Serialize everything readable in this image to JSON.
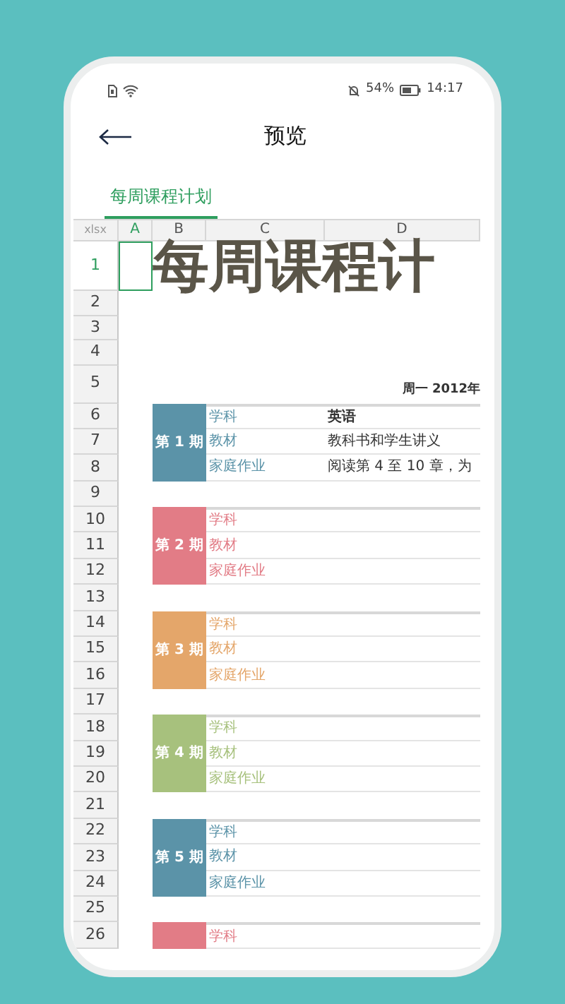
{
  "status_bar": {
    "battery": "54%",
    "time": "14:17"
  },
  "header": {
    "title": "预览"
  },
  "tabs": [
    {
      "label": "每周课程计划",
      "selected": true
    }
  ],
  "sheet": {
    "corner": "xlsx",
    "columns": [
      {
        "label": "A",
        "selected": true
      },
      {
        "label": "B",
        "selected": false
      },
      {
        "label": "C",
        "selected": false
      },
      {
        "label": "D",
        "selected": false
      }
    ],
    "rows": [
      {
        "label": "1",
        "selected": true
      },
      {
        "label": "2",
        "selected": false
      },
      {
        "label": "3",
        "selected": false
      },
      {
        "label": "4",
        "selected": false
      },
      {
        "label": "5",
        "selected": false
      },
      {
        "label": "6",
        "selected": false
      },
      {
        "label": "7",
        "selected": false
      },
      {
        "label": "8",
        "selected": false
      },
      {
        "label": "9",
        "selected": false
      },
      {
        "label": "10",
        "selected": false
      },
      {
        "label": "11",
        "selected": false
      },
      {
        "label": "12",
        "selected": false
      },
      {
        "label": "13",
        "selected": false
      },
      {
        "label": "14",
        "selected": false
      },
      {
        "label": "15",
        "selected": false
      },
      {
        "label": "16",
        "selected": false
      },
      {
        "label": "17",
        "selected": false
      },
      {
        "label": "18",
        "selected": false
      },
      {
        "label": "19",
        "selected": false
      },
      {
        "label": "20",
        "selected": false
      },
      {
        "label": "21",
        "selected": false
      },
      {
        "label": "22",
        "selected": false
      },
      {
        "label": "23",
        "selected": false
      },
      {
        "label": "24",
        "selected": false
      },
      {
        "label": "25",
        "selected": false
      },
      {
        "label": "26",
        "selected": false
      }
    ],
    "title": "每周课程计",
    "date": "周一 2012年",
    "blocks": [
      {
        "label": "第 1 期",
        "color": "#5b93a8",
        "lines": [
          {
            "label": "学科",
            "value": "英语"
          },
          {
            "label": "教材",
            "value": "教科书和学生讲义"
          },
          {
            "label": "家庭作业",
            "value": "阅读第 4 至 10 章，为"
          }
        ]
      },
      {
        "label": "第 2 期",
        "color": "#e27c86",
        "lines": [
          {
            "label": "学科"
          },
          {
            "label": "教材"
          },
          {
            "label": "家庭作业"
          }
        ]
      },
      {
        "label": "第 3 期",
        "color": "#e4a66a",
        "lines": [
          {
            "label": "学科"
          },
          {
            "label": "教材"
          },
          {
            "label": "家庭作业"
          }
        ]
      },
      {
        "label": "第 4 期",
        "color": "#a7c17d",
        "lines": [
          {
            "label": "学科"
          },
          {
            "label": "教材"
          },
          {
            "label": "家庭作业"
          }
        ]
      },
      {
        "label": "第 5 期",
        "color": "#5b93a8",
        "lines": [
          {
            "label": "学科"
          },
          {
            "label": "教材"
          },
          {
            "label": "家庭作业"
          }
        ]
      },
      {
        "color": "#e27c86",
        "lines": [
          {
            "label": "学科"
          }
        ]
      }
    ]
  }
}
